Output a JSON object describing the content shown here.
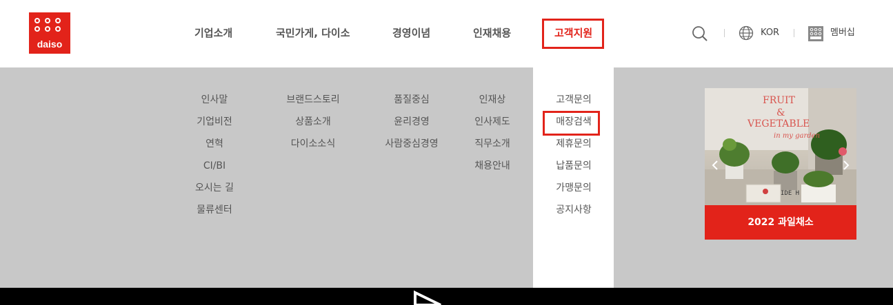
{
  "logo": {
    "text": "daiso"
  },
  "gnb": [
    {
      "label": "기업소개"
    },
    {
      "label": "국민가게, 다이소"
    },
    {
      "label": "경영이념"
    },
    {
      "label": "인재채용"
    },
    {
      "label": "고객지원"
    }
  ],
  "utility": {
    "lang": "KOR",
    "membership": "멤버십"
  },
  "submenu": {
    "company": [
      "인사말",
      "기업비전",
      "연혁",
      "CI/BI",
      "오시는 길",
      "물류센터"
    ],
    "store": [
      "브랜드스토리",
      "상품소개",
      "다이소소식"
    ],
    "philosophy": [
      "품질중심",
      "윤리경영",
      "사람중심경영"
    ],
    "recruit": [
      "인재상",
      "인사제도",
      "직무소개",
      "채용안내"
    ],
    "support": [
      "고객문의",
      "매장검색",
      "제휴문의",
      "납품문의",
      "가맹문의",
      "공지사항"
    ]
  },
  "promo": {
    "caption": "2022 과일채소",
    "art_line1": "FRUIT",
    "art_line2": "&",
    "art_line3": "VEGETABLE",
    "art_line4": "in my garden",
    "box_text": "IDE  H"
  },
  "colors": {
    "brand": "#e2231a",
    "megamenu_bg": "#c8c8c8"
  }
}
